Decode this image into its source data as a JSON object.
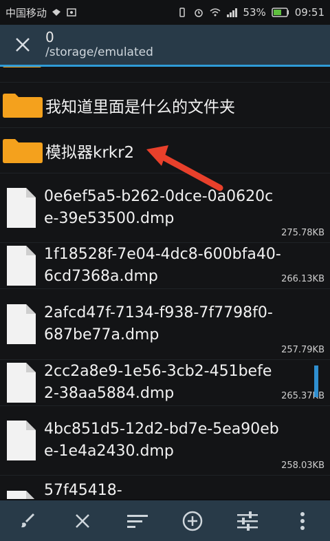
{
  "status": {
    "carrier": "中国移动",
    "battery": "53%",
    "time": "09:51"
  },
  "header": {
    "count": "0",
    "path": "/storage/emulated"
  },
  "items": [
    {
      "type": "folder",
      "name": "我知道里面是什么的文件夹"
    },
    {
      "type": "folder",
      "name": "模拟器krkr2"
    },
    {
      "type": "file",
      "name": "0e6ef5a5-b262-0dce-0a0620ce-39e53500.dmp",
      "size": "275.78KB"
    },
    {
      "type": "file",
      "name": "1f18528f-7e04-4dc8-600bfa40-6cd7368a.dmp",
      "size": "266.13KB"
    },
    {
      "type": "file",
      "name": "2afcd47f-7134-f938-7f7798f0-687be77a.dmp",
      "size": "257.79KB"
    },
    {
      "type": "file",
      "name": "2cc2a8e9-1e56-3cb2-451befe2-38aa5884.dmp",
      "size": "265.37KB"
    },
    {
      "type": "file",
      "name": "4bc851d5-12d2-bd7e-5ea90ebe-1e4a2430.dmp",
      "size": "258.03KB"
    },
    {
      "type": "file",
      "name": "57f45418-"
    }
  ],
  "icons": {
    "close": "close-icon",
    "bottom": [
      "brush-icon",
      "close-icon",
      "sort-icon",
      "add-circle-icon",
      "filter-icon",
      "more-vert-icon"
    ]
  },
  "colors": {
    "accent": "#2f9bd7",
    "folder": "#f4a11d",
    "bar": "#283a48",
    "arrow": "#e8402b"
  }
}
